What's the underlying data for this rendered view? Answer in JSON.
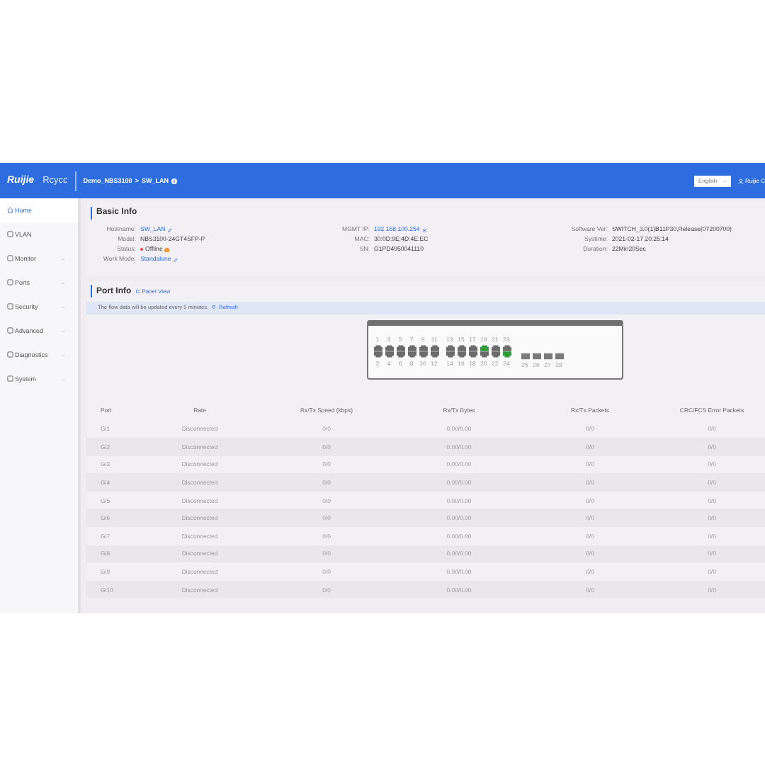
{
  "header": {
    "brand": "Ruijie",
    "product": "Rcycc",
    "breadcrumb": [
      "Demo_NBS3100",
      "SW_LAN"
    ],
    "breadcrumb_separator": ">",
    "language": "English",
    "account": "Ruijie C"
  },
  "sidebar": {
    "items": [
      {
        "label": "Home",
        "selected": true,
        "has_submenu": false
      },
      {
        "label": "VLAN",
        "selected": false,
        "has_submenu": false
      },
      {
        "label": "Monitor",
        "selected": false,
        "has_submenu": true
      },
      {
        "label": "Ports",
        "selected": false,
        "has_submenu": true
      },
      {
        "label": "Security",
        "selected": false,
        "has_submenu": true
      },
      {
        "label": "Advanced",
        "selected": false,
        "has_submenu": true
      },
      {
        "label": "Diagnostics",
        "selected": false,
        "has_submenu": true
      },
      {
        "label": "System",
        "selected": false,
        "has_submenu": true
      }
    ]
  },
  "basic_info": {
    "title": "Basic Info",
    "columns": [
      [
        {
          "label": "Hostname:",
          "value": "SW_LAN",
          "kind": "edit-link"
        },
        {
          "label": "Model:",
          "value": "NBS3100-24GT4SFP-P",
          "kind": "plain"
        },
        {
          "label": "Status:",
          "value": "Offline",
          "kind": "status"
        },
        {
          "label": "Work Mode:",
          "value": "Standalone",
          "kind": "edit-link"
        }
      ],
      [
        {
          "label": "MGMT IP:",
          "value": "192.168.100.254",
          "kind": "link"
        },
        {
          "label": "MAC:",
          "value": "30:0D:9E:4D:4E:EC",
          "kind": "plain"
        },
        {
          "label": "SN:",
          "value": "G1PD4950041110",
          "kind": "plain"
        }
      ],
      [
        {
          "label": "Software Ver:",
          "value": "SWITCH_3.0(1)B11P30,Release(07200700)",
          "kind": "plain"
        },
        {
          "label": "Systime:",
          "value": "2021-02-17 20:25:14",
          "kind": "plain"
        },
        {
          "label": "Duration:",
          "value": "22Min20Sec",
          "kind": "plain"
        }
      ]
    ]
  },
  "port_info": {
    "title": "Port Info",
    "panel_view": "Panel View",
    "notice": "The flow data will be updated every 5 minutes.",
    "refresh": "Refresh",
    "ports": [
      {
        "label": "1",
        "linked": false
      },
      {
        "label": "2",
        "linked": false
      },
      {
        "label": "3",
        "linked": false
      },
      {
        "label": "4",
        "linked": false
      },
      {
        "label": "5",
        "linked": false
      },
      {
        "label": "6",
        "linked": false
      },
      {
        "label": "7",
        "linked": false
      },
      {
        "label": "8",
        "linked": false
      },
      {
        "label": "9",
        "linked": false
      },
      {
        "label": "10",
        "linked": false
      },
      {
        "label": "11",
        "linked": false
      },
      {
        "label": "12",
        "linked": false
      },
      {
        "label": "13",
        "linked": false
      },
      {
        "label": "14",
        "linked": false
      },
      {
        "label": "15",
        "linked": false
      },
      {
        "label": "16",
        "linked": false
      },
      {
        "label": "17",
        "linked": false
      },
      {
        "label": "18",
        "linked": false
      },
      {
        "label": "19",
        "linked": true
      },
      {
        "label": "20",
        "linked": false
      },
      {
        "label": "21",
        "linked": false
      },
      {
        "label": "22",
        "linked": false
      },
      {
        "label": "23",
        "linked": false
      },
      {
        "label": "24",
        "linked": true
      }
    ],
    "sfp_ports": [
      "25",
      "26",
      "27",
      "28"
    ]
  },
  "table": {
    "columns": [
      "Port",
      "Rate",
      "Rx/Tx Speed (kbps)",
      "Rx/Tx Bytes",
      "Rx/Tx Packets",
      "CRC/FCS Error Packets"
    ],
    "rows": [
      [
        "Gi1",
        "Disconnected",
        "0/0",
        "0.00/0.00",
        "0/0",
        "0/0"
      ],
      [
        "Gi2",
        "Disconnected",
        "0/0",
        "0.00/0.00",
        "0/0",
        "0/0"
      ],
      [
        "Gi3",
        "Disconnected",
        "0/0",
        "0.00/0.00",
        "0/0",
        "0/0"
      ],
      [
        "Gi4",
        "Disconnected",
        "0/0",
        "0.00/0.00",
        "0/0",
        "0/0"
      ],
      [
        "Gi5",
        "Disconnected",
        "0/0",
        "0.00/0.00",
        "0/0",
        "0/0"
      ],
      [
        "Gi6",
        "Disconnected",
        "0/0",
        "0.00/0.00",
        "0/0",
        "0/0"
      ],
      [
        "Gi7",
        "Disconnected",
        "0/0",
        "0.00/0.00",
        "0/0",
        "0/0"
      ],
      [
        "Gi8",
        "Disconnected",
        "0/0",
        "0.00/0.00",
        "0/0",
        "0/0"
      ],
      [
        "Gi9",
        "Disconnected",
        "0/0",
        "0.00/0.00",
        "0/0",
        "0/0"
      ],
      [
        "Gi10",
        "Disconnected",
        "0/0",
        "0.00/0.00",
        "0/0",
        "0/0"
      ]
    ]
  }
}
